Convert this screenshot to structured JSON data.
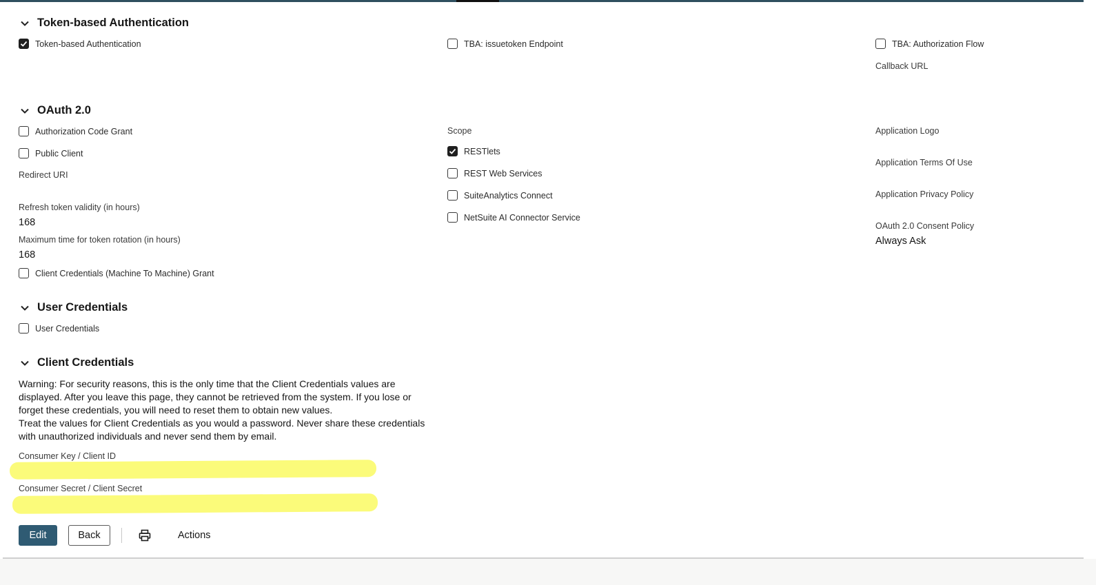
{
  "tba": {
    "title": "Token-based Authentication",
    "checkbox_tba": "Token-based Authentication",
    "checkbox_issuetoken": "TBA: issuetoken Endpoint",
    "checkbox_authflow": "TBA: Authorization Flow",
    "callback_label": "Callback URL"
  },
  "oauth": {
    "title": "OAuth 2.0",
    "auth_code_grant": "Authorization Code Grant",
    "public_client": "Public Client",
    "redirect_uri_label": "Redirect URI",
    "refresh_label": "Refresh token validity (in hours)",
    "refresh_value": "168",
    "rotation_label": "Maximum time for token rotation (in hours)",
    "rotation_value": "168",
    "client_credentials_grant": "Client Credentials (Machine To Machine) Grant",
    "scope_label": "Scope",
    "scopes": [
      {
        "label": "RESTlets",
        "checked": true
      },
      {
        "label": "REST Web Services",
        "checked": false
      },
      {
        "label": "SuiteAnalytics Connect",
        "checked": false
      },
      {
        "label": "NetSuite AI Connector Service",
        "checked": false
      }
    ],
    "app_logo_label": "Application Logo",
    "terms_label": "Application Terms Of Use",
    "privacy_label": "Application Privacy Policy",
    "consent_label": "OAuth 2.0 Consent Policy",
    "consent_value": "Always Ask"
  },
  "user_credentials": {
    "title": "User Credentials",
    "checkbox": "User Credentials"
  },
  "client_credentials": {
    "title": "Client Credentials",
    "warning_1": "Warning: For security reasons, this is the only time that the Client Credentials values are displayed. After you leave this page, they cannot be retrieved from the system. If you lose or forget these credentials, you will need to reset them to obtain new values.",
    "warning_2": "Treat the values for Client Credentials as you would a password. Never share these credentials with unauthorized individuals and never send them by email.",
    "consumer_key_label": "Consumer Key / Client ID",
    "consumer_secret_label": "Consumer Secret / Client Secret"
  },
  "toolbar": {
    "edit": "Edit",
    "back": "Back",
    "actions": "Actions"
  },
  "colors": {
    "primary_button": "#2f5b73",
    "redaction_highlight": "#fbfb7a"
  }
}
